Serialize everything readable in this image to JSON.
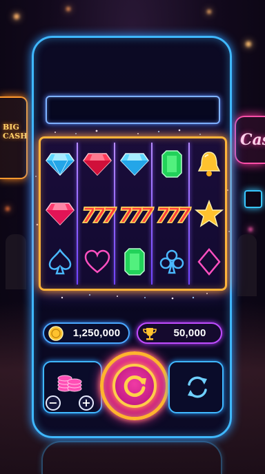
{
  "game": {
    "title_bar_text": "",
    "balance": {
      "value": "1,250,000",
      "icon": "coin-icon"
    },
    "win": {
      "value": "50,000",
      "icon": "trophy-icon"
    },
    "reels": [
      [
        "blue-diamond",
        "red-gem",
        "green-emerald-7",
        "spade"
      ],
      [
        "red-diamond",
        "triple-seven",
        "heart"
      ],
      [
        "blue-diamond",
        "triple-seven",
        "green-emerald"
      ],
      [
        "green-emerald",
        "triple-seven",
        "club"
      ],
      [
        "gold-bell",
        "gold-star",
        "diamond-suit"
      ]
    ],
    "controls": {
      "bet_minus": "−",
      "bet_plus": "+",
      "spin_icon": "spin-icon",
      "auto_icon": "autospin-icon"
    },
    "background_signs": {
      "left": "BIG\nCASH",
      "right": "Casi"
    }
  },
  "colors": {
    "frame_blue": "#3fb8ff",
    "reel_gold": "#ffb43a",
    "spin_pink": "#d81a8c",
    "win_purple": "#c04dff"
  }
}
